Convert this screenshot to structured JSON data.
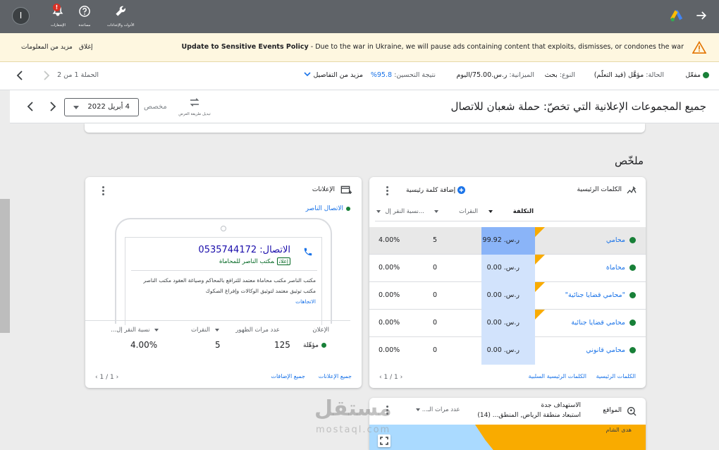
{
  "topbar": {
    "avatar_letter": "I",
    "alerts_label": "الإشعارات",
    "help_label": "مساعدة",
    "tools_label": "الأدوات والإعدادات",
    "alert_count": "!"
  },
  "banner": {
    "message_bold": "Update to Sensitive Events Policy",
    "message_rest": " - Due to the war in Ukraine, we will pause ads containing content that exploits, dismisses, or condones the war",
    "close_label": "إغلاق",
    "more_info_label": "مزيد من المعلومات"
  },
  "campaign": {
    "status_label": "مفعّل",
    "state_label": "الحالة:",
    "state_value": "مؤهَّل (قيد التعلّم)",
    "type_label": "النوع:",
    "type_value": "بحث",
    "budget_label": "الميزانية:",
    "budget_value": "ر.س.‏75.00/اليوم",
    "optimization_label": "نتيجة التحسين:",
    "optimization_value": "95.8%",
    "more_details": "مزيد من التفاصيل",
    "pager": "الحملة 1 من 2"
  },
  "header": {
    "title": "جميع المجموعات الإعلانية التي تخصّ: حملة شعبان للاتصال",
    "date_value": "4 أبريل 2022",
    "custom_label": "مخصص",
    "swap_label": "تبديل طريقة العرض"
  },
  "summary_title": "ملخّص",
  "keywords_card": {
    "title": "الكلمات الرئيسية",
    "add_keyword": "إضافة كلمة رئيسية",
    "columns": {
      "cost": "التكلفة",
      "clicks": "النقرات",
      "ctr": "نسبة النقر إل..."
    },
    "rows": [
      {
        "name": "محامي",
        "cost": "ر.س.‏ 99.92",
        "clicks": "5",
        "ctr": "4.00%"
      },
      {
        "name": "محاماة",
        "cost": "ر.س.‏ 0.00",
        "clicks": "0",
        "ctr": "0.00%"
      },
      {
        "name": "\"محامي قضايا جنائية\"",
        "cost": "ر.س.‏ 0.00",
        "clicks": "0",
        "ctr": "0.00%"
      },
      {
        "name": "محامي قضايا جنائية",
        "cost": "ر.س.‏ 0.00",
        "clicks": "0",
        "ctr": "0.00%"
      },
      {
        "name": "محامي قانوني",
        "cost": "ر.س.‏ 0.00",
        "clicks": "0",
        "ctr": "0.00%"
      }
    ],
    "footer_keywords": "الكلمات الرئيسية",
    "footer_negative": "الكلمات الرئيسية السلبية",
    "pager": "1 / 1"
  },
  "ads_card": {
    "title": "الإعلانات",
    "ad_name": "الاتصال الناصر",
    "call_label": "الاتصال:",
    "call_number": "0535744172",
    "ad_tag": "إعلان",
    "advertiser": "مكتب الناصر للمحاماة",
    "desc_line1": "مكتب الناصر مكتب محاماة معتمد للترافع بالمحاكم وصياغة العقود مكتب الناصر",
    "desc_line2": "مكتب توثيق معتمد لتوثيق الوكالات وإفراغ الصكوك",
    "directions": "الاتجاهات",
    "stats_labels": {
      "ad": "الإعلان",
      "impressions": "عدد مرات الظهور",
      "clicks": "النقرات",
      "ctr": "نسبة النقر إل..."
    },
    "stats_values": {
      "status": "مؤهّلة",
      "impressions": "125",
      "clicks": "5",
      "ctr": "4.00%"
    },
    "footer_all_ads": "جميع الإعلانات",
    "footer_all_extensions": "جميع الإضافات",
    "pager": "1 / 1"
  },
  "locations_card": {
    "title": "المواقع",
    "targeting_label": "الاستهداف جدة",
    "exclusion_label": "استبعاد منطقة الرياض, المنطق...",
    "exclusion_count": "(14)",
    "metric_select": "عدد مرات الـ...",
    "map_label": "هدى الشام"
  },
  "watermark": {
    "arabic": "مستقل",
    "latin": "mostaql.com"
  }
}
